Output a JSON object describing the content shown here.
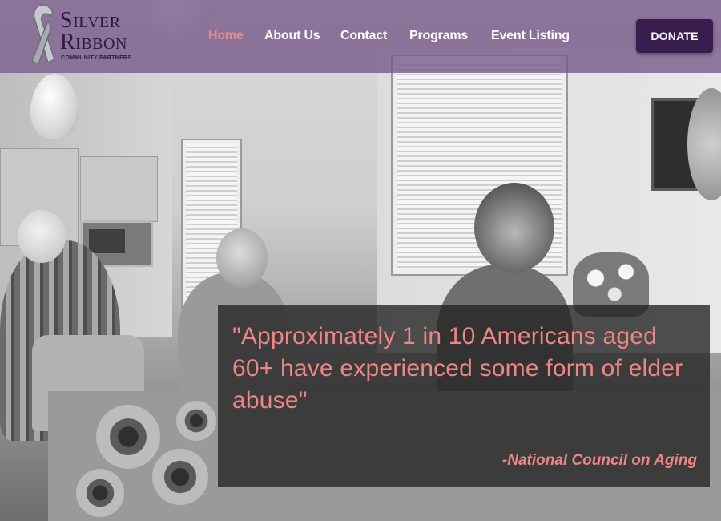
{
  "brand": {
    "name_line1": "Silver",
    "name_line2": "Ribbon",
    "tagline": "COMMUNITY PARTNERS",
    "ribbon_color": "#b9b9c2",
    "text_color": "#2e1746"
  },
  "nav": {
    "items": [
      {
        "label": "Home",
        "active": true
      },
      {
        "label": "About Us",
        "active": false
      },
      {
        "label": "Contact",
        "active": false
      },
      {
        "label": "Programs",
        "active": false
      },
      {
        "label": "Event Listing",
        "active": false
      }
    ],
    "active_color": "#e98b8b"
  },
  "donate": {
    "label": "DONATE",
    "bg": "#3a1d4f"
  },
  "header": {
    "bg": "#765688"
  },
  "quote": {
    "text": "\"Approximately 1 in 10 Americans aged 60+ have experienced some form of elder abuse\"",
    "source": "-National Council on Aging",
    "color": "#ef8585"
  }
}
